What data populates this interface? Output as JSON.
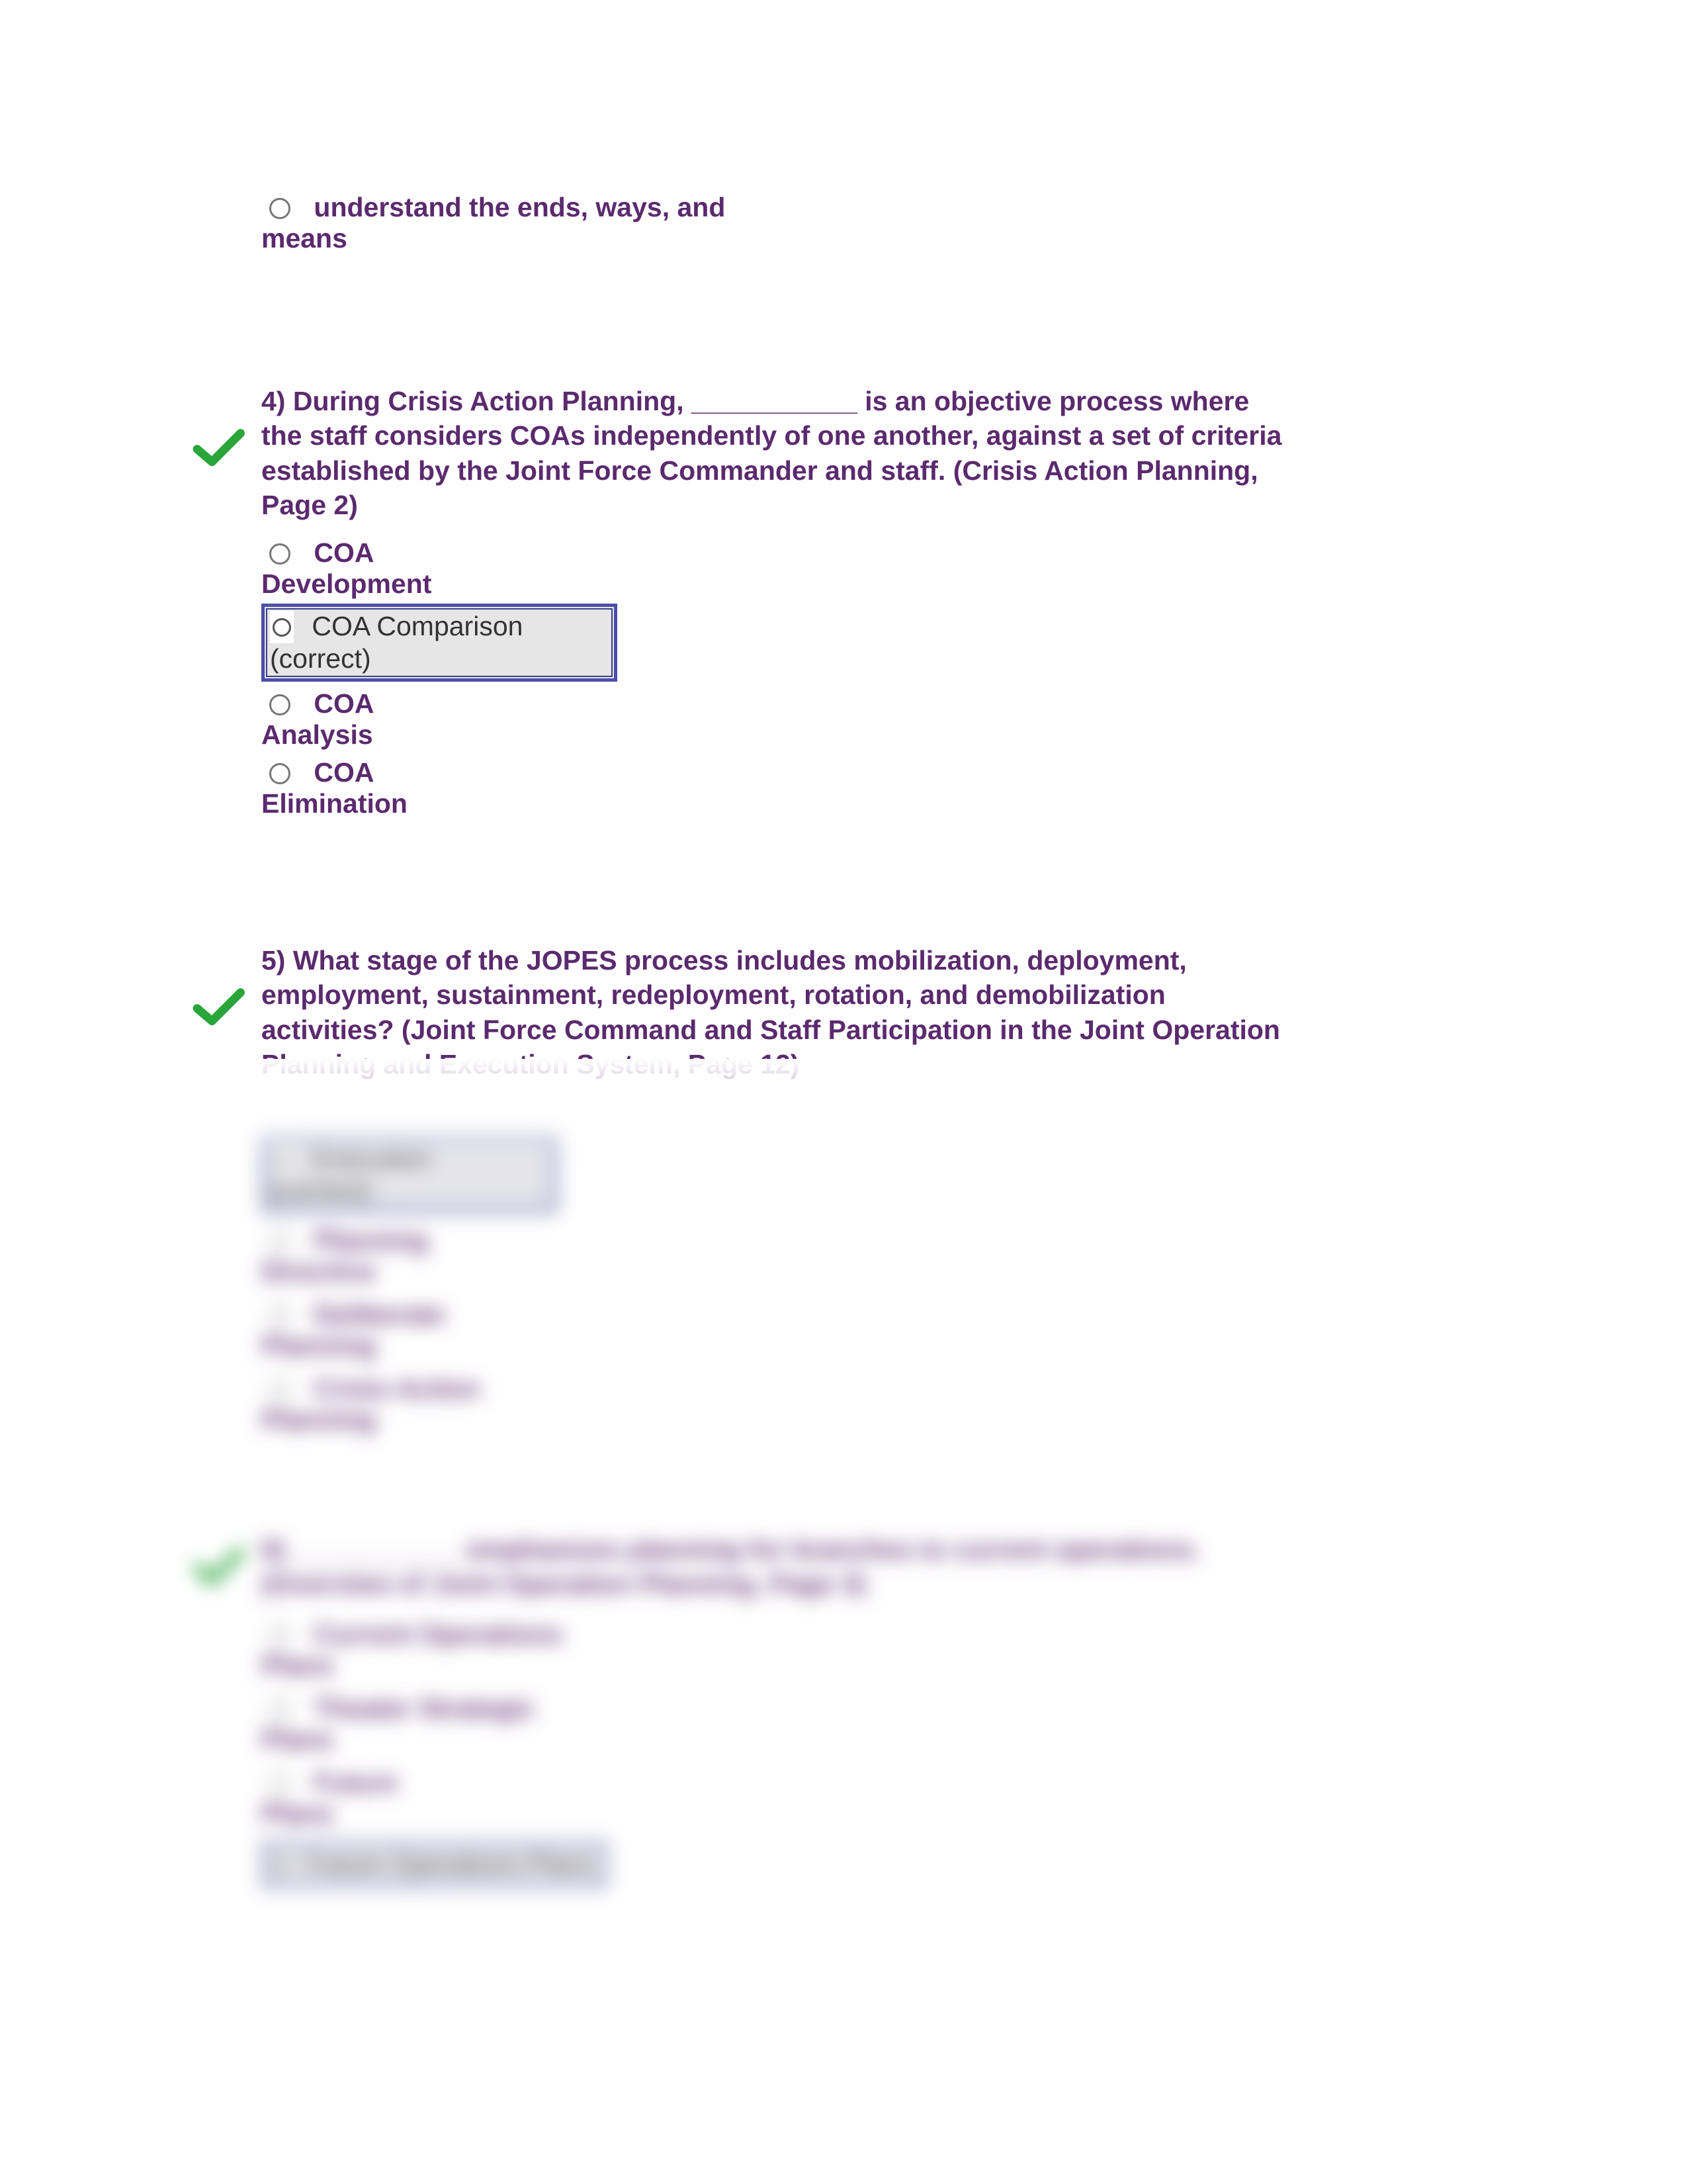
{
  "orphan_option": {
    "label": "understand the ends, ways, and",
    "cont": "means"
  },
  "q4": {
    "prompt": "4) During Crisis Action Planning, ___________ is an objective process where the staff considers COAs independently of one another, against a set of criteria established by the Joint Force Commander and staff. (Crisis Action Planning, Page 2)",
    "opt_a": "COA",
    "opt_a_cont": "Development",
    "correct_label": "COA Comparison",
    "correct_sub": "(correct)",
    "opt_c": "COA",
    "opt_c_cont": "Analysis",
    "opt_d": "COA",
    "opt_d_cont": "Elimination"
  },
  "q5": {
    "prompt": "5) What stage of the JOPES process includes mobilization, deployment, employment, sustainment, redeployment, rotation, and demobilization activities? (Joint Force Command and Staff Participation in the Joint Operation Planning and Execution System, Page 12)",
    "correct_label": "Execution",
    "correct_sub": "(correct)",
    "opt_b": "Planning",
    "opt_b_cont": "Directive",
    "opt_c": "Deliberate",
    "opt_c_cont": "Planning",
    "opt_d": "Crisis Action",
    "opt_d_cont": "Planning"
  },
  "q6": {
    "prompt": "6) ___________ emphasizes planning for branches to current operations. (Overview of Joint Operation Planning, Page 3)",
    "opt_a": "Current Operations",
    "opt_a_cont": "Plans",
    "opt_b": "Theater Strategic",
    "opt_b_cont": "Plans",
    "opt_c": "Future",
    "opt_c_cont": "Plans",
    "correct_label": "Future Operations Plans"
  }
}
